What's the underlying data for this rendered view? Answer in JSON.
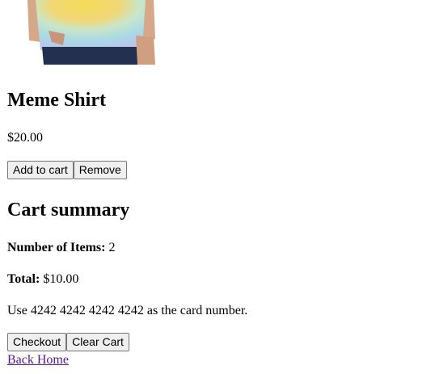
{
  "product": {
    "image_icon": "tie-dye-shirt-photo",
    "name": "Meme Shirt",
    "price": "$20.00",
    "add_to_cart_label": "Add to cart",
    "remove_label": "Remove"
  },
  "cart": {
    "heading": "Cart summary",
    "items_label": "Number of Items:",
    "items_value": "2",
    "total_label": "Total:",
    "total_value": "$10.00",
    "card_hint": "Use 4242 4242 4242 4242 as the card number.",
    "checkout_label": "Checkout",
    "clear_label": "Clear Cart"
  },
  "nav": {
    "back_home_label": "Back Home"
  },
  "colors": {
    "link_visited": "#551a8b",
    "button_bg": "#efefef",
    "button_border": "#767676"
  }
}
